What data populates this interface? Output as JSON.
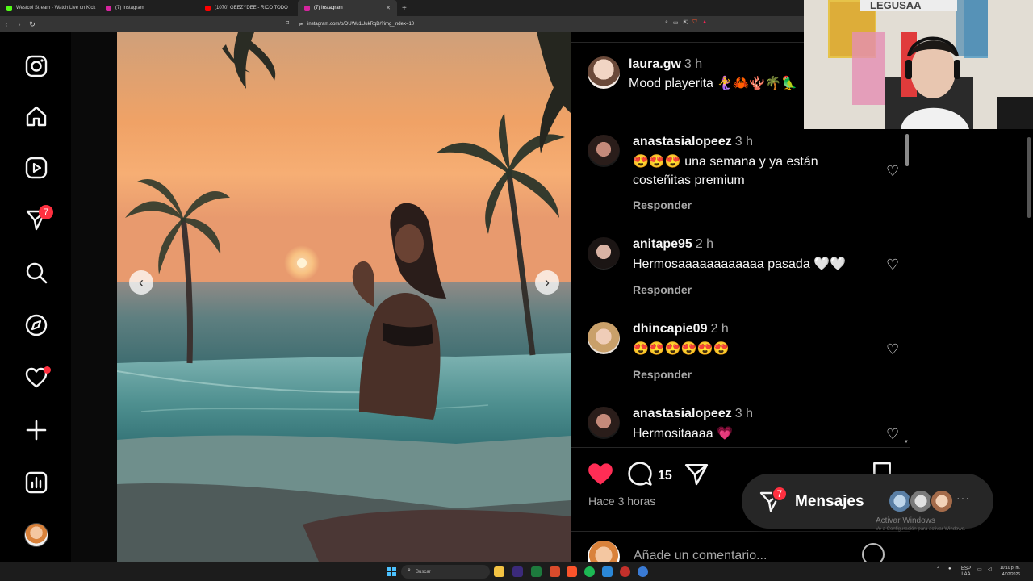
{
  "browser": {
    "tabs": [
      {
        "label": "Westcol Stream - Watch Live on Kick",
        "favicon_color": "#53fc18",
        "active": false
      },
      {
        "label": "(7) Instagram",
        "favicon_color": "#d6249f",
        "active": false
      },
      {
        "label": "(1070) GEEZYDEE - RICO TODO",
        "favicon_color": "#ff0000",
        "active": false
      },
      {
        "label": "(7) Instagram",
        "favicon_color": "#d6249f",
        "active": true
      }
    ],
    "new_tab": "+",
    "url": "instagram.com/p/DUWu1UukRqD/?img_index=10"
  },
  "sidebar": {
    "messages_badge": "7",
    "icons": [
      "instagram-logo-icon",
      "home-icon",
      "reels-icon",
      "messages-icon",
      "search-icon",
      "explore-icon",
      "notifications-icon",
      "create-icon",
      "dashboard-icon",
      "profile-avatar"
    ]
  },
  "post": {
    "image_description_icons": [
      "prev-arrow-icon",
      "next-arrow-icon"
    ],
    "author": {
      "username": "laura.gw",
      "time": "3 h",
      "caption": "Mood playerita 🧜‍♀️🦀🪸🌴🦜"
    },
    "comments": [
      {
        "username": "anastasialopeez",
        "time": "3 h",
        "text": "😍😍😍 una semana y ya están costeñitas premium",
        "reply": "Responder"
      },
      {
        "username": "anitape95",
        "time": "2 h",
        "text": "Hermosaaaaaaaaaaaa pasada 🤍🤍",
        "reply": "Responder"
      },
      {
        "username": "dhincapie09",
        "time": "2 h",
        "text": "😍😍😍😍😍😍",
        "reply": "Responder"
      },
      {
        "username": "anastasialopeez",
        "time": "3 h",
        "text": "Hermositaaaa 💗",
        "reply": ""
      }
    ],
    "likes_count": "15",
    "posted_ago": "Hace 3 horas",
    "comment_placeholder": "Añade un comentario..."
  },
  "messages_pill": {
    "label": "Mensajes",
    "badge": "7",
    "more": "···"
  },
  "watermark": {
    "title": "Activar Windows",
    "subtitle": "Ve a Configuración para activar Windows."
  },
  "webcam": {
    "banner": "LEGUSAA"
  },
  "taskbar": {
    "search_placeholder": "Buscar",
    "language": "ESP",
    "language_sub": "LAA",
    "time": "10:10 p. m.",
    "date": "4/02/2026"
  },
  "colors": {
    "accent_red": "#ff2d55",
    "badge_red": "#ff3040",
    "bg": "#000000",
    "panel_border": "#262626"
  }
}
